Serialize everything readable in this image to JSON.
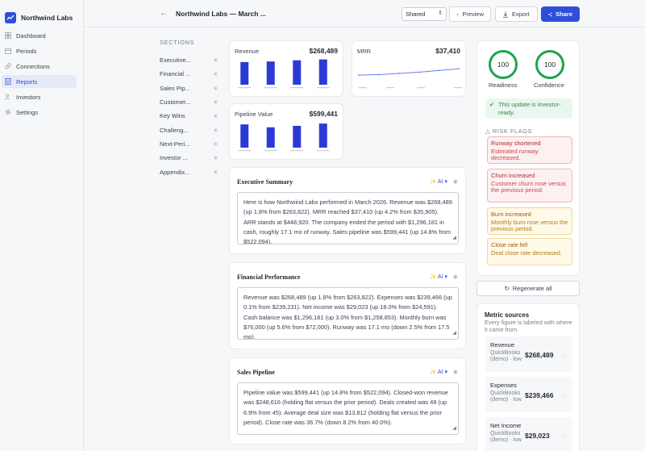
{
  "app": {
    "name": "Northwind Labs"
  },
  "sidebar": {
    "items": [
      {
        "label": "Dashboard",
        "icon": "grid-icon",
        "active": false
      },
      {
        "label": "Periods",
        "icon": "calendar-icon",
        "active": false
      },
      {
        "label": "Connections",
        "icon": "link-icon",
        "active": false
      },
      {
        "label": "Reports",
        "icon": "document-icon",
        "active": true
      },
      {
        "label": "Investors",
        "icon": "people-icon",
        "active": false
      },
      {
        "label": "Settings",
        "icon": "gear-icon",
        "active": false
      }
    ]
  },
  "topbar": {
    "title": "Northwind Labs — March ...",
    "visibility": "Shared",
    "preview_label": "Preview",
    "export_label": "Export",
    "share_label": "Share"
  },
  "sections": {
    "heading": "SECTIONS",
    "items": [
      "Executive...",
      "Financial ...",
      "Sales Pip...",
      "Customer...",
      "Key Wins",
      "Challeng...",
      "Next-Peri...",
      "Investor ...",
      "Appendix..."
    ]
  },
  "metrics": {
    "revenue": {
      "label": "Revenue",
      "value": "$268,489"
    },
    "mrr": {
      "label": "MRR",
      "value": "$37,410"
    },
    "pipeline": {
      "label": "Pipeline Value",
      "value": "$599,441"
    }
  },
  "report_sections": [
    {
      "title": "Executive Summary",
      "ai_label": "AI",
      "text": "Here is how Northwind Labs performed in March 2026. Revenue was $268,489 (up 1.8% from $263,822). MRR reached $37,410 (up 4.2% from $35,905). ARR stands at $448,920. The company ended the period with $1,296,181 in cash, roughly 17.1 mo of runway. Sales pipeline was $599,441 (up 14.8% from $522,094)."
    },
    {
      "title": "Financial Performance",
      "ai_label": "AI",
      "text": "Revenue was $268,489 (up 1.8% from $263,822). Expenses was $239,466 (up 0.1% from $239,231). Net income was $29,023 (up 18.0% from $24,591). Cash balance was $1,296,181 (up 3.0% from $1,258,853). Monthly burn was $76,000 (up 5.6% from $72,000). Runway was 17.1 mo (down 2.5% from 17.5 mo)."
    },
    {
      "title": "Sales Pipeline",
      "ai_label": "AI",
      "text": "Pipeline value was $599,441 (up 14.8% from $522,094). Closed-won revenue was $248,616 (holding flat versus the prior period). Deals created was 49 (up 6.9% from 45). Average deal size was $13,812 (holding flat versus the prior period). Close rate was 36.7% (down 8.2% from 40.0%)."
    }
  ],
  "readiness": {
    "readiness_score": "100",
    "readiness_label": "Readiness",
    "confidence_score": "100",
    "confidence_label": "Confidence",
    "note": "This update is investor-ready.",
    "ring_color": "#1fa34a"
  },
  "risk_flags": {
    "heading": "RISK FLAGS",
    "items": [
      {
        "title": "Runway shortened",
        "desc": "Estimated runway decreased.",
        "severity": "red"
      },
      {
        "title": "Churn increased",
        "desc": "Customer churn rose versus the previous period.",
        "severity": "red"
      },
      {
        "title": "Burn increased",
        "desc": "Monthly burn rose versus the previous period.",
        "severity": "amber"
      },
      {
        "title": "Close rate fell",
        "desc": "Deal close rate decreased.",
        "severity": "amber"
      }
    ]
  },
  "regenerate_label": "Regenerate all",
  "metric_sources": {
    "heading": "Metric sources",
    "sub": "Every figure is labeled with where it came from.",
    "items": [
      {
        "name": "Revenue",
        "meta": "QuickBooks (demo) · low",
        "value": "$268,489"
      },
      {
        "name": "Expenses",
        "meta": "QuickBooks (demo) · low",
        "value": "$239,466"
      },
      {
        "name": "Net Income",
        "meta": "QuickBooks (demo) · low",
        "value": "$29,023"
      }
    ]
  },
  "colors": {
    "accent": "#2f4fd8",
    "bar": "#2b3ad6",
    "line": "#6b7ef0",
    "good": "#1fa34a"
  },
  "chart_data": [
    {
      "type": "bar",
      "title": "Revenue",
      "values": [
        0.78,
        0.8,
        0.84,
        0.87
      ]
    },
    {
      "type": "line",
      "title": "MRR",
      "values": [
        0.44,
        0.46,
        0.5,
        0.54,
        0.6,
        0.66
      ]
    },
    {
      "type": "bar",
      "title": "Pipeline Value",
      "values": [
        0.8,
        0.7,
        0.75,
        0.83
      ]
    }
  ]
}
